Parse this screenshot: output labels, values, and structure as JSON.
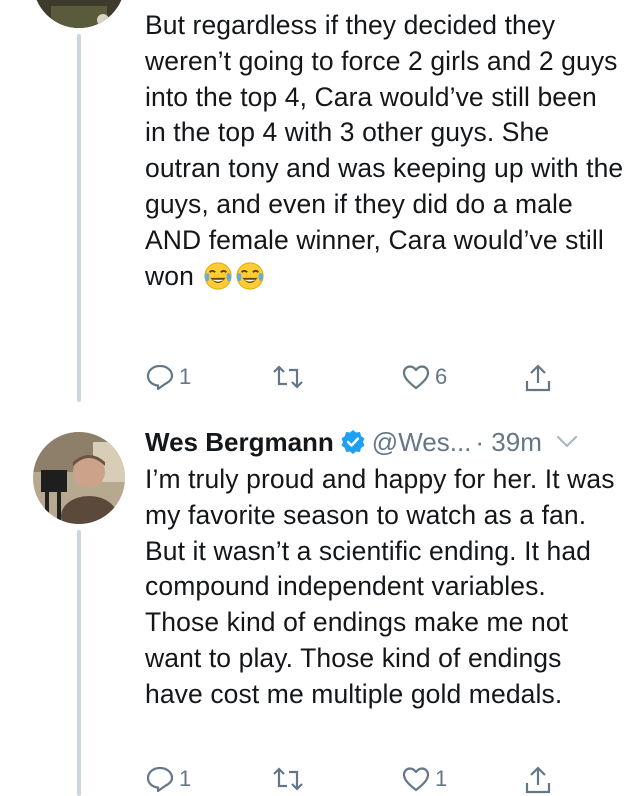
{
  "tweets": [
    {
      "text": "But regardless if they decided they weren’t going to force 2 girls and 2 guys into the top 4, Cara would’ve still been in the top 4 with 3 other guys. She outran tony and was keeping up with the guys, and even if they did do a male AND female winner, Cara would’ve still won",
      "emojis": [
        "face-with-tears-of-joy",
        "face-with-tears-of-joy"
      ],
      "reply_count": "1",
      "retweet_count": "",
      "like_count": "6"
    },
    {
      "author_name": "Wes Bergmann",
      "verified": true,
      "handle": "@Wes...",
      "time": "· 39m",
      "text": "I’m truly proud and happy for her. It was my favorite season to watch as a fan. But it wasn’t a scientific ending. It had compound independent variables. Those kind of endings make me not want to play. Those kind of endings have cost me multiple gold medals.",
      "reply_count": "1",
      "retweet_count": "",
      "like_count": "1"
    }
  ],
  "colors": {
    "accent": "#1da1f2",
    "muted": "#657786",
    "thread_line": "#ccd6dd"
  }
}
